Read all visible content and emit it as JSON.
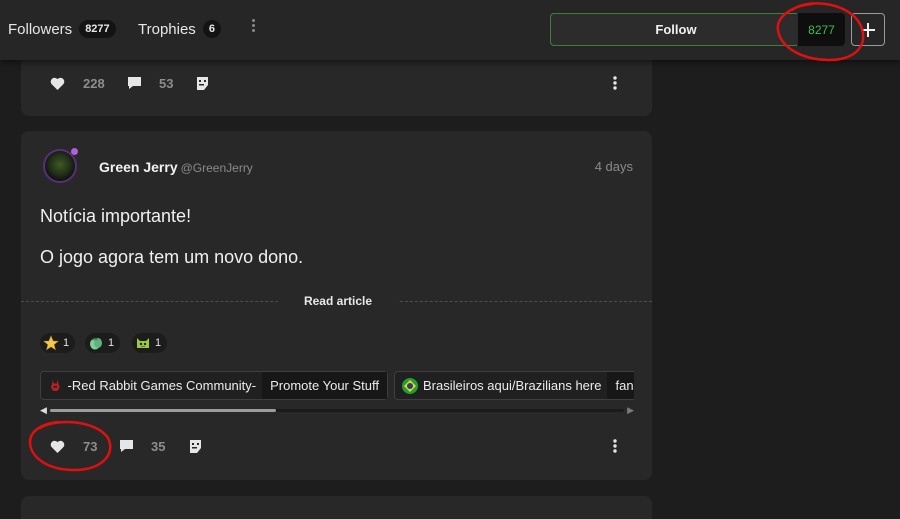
{
  "topbar": {
    "followers_label": "Followers",
    "followers_count": "8277",
    "trophies_label": "Trophies",
    "trophies_count": "6",
    "follow_label": "Follow",
    "follow_count": "8277"
  },
  "previous_post": {
    "likes": "228",
    "comments": "53"
  },
  "post": {
    "author_name": "Green Jerry",
    "author_handle": "@GreenJerry",
    "time": "4 days",
    "lines": [
      "Notícia importante!",
      "O jogo agora tem um novo dono."
    ],
    "read_article_label": "Read article",
    "reactions": [
      {
        "icon": "star-reaction-icon",
        "count": "1"
      },
      {
        "icon": "clapping-hands-reaction-icon",
        "count": "1"
      },
      {
        "icon": "cat-reaction-icon",
        "count": "1"
      }
    ],
    "communities": [
      {
        "name": "-Red Rabbit Games Community-",
        "extra": "Promote Your Stuff"
      },
      {
        "name": "Brasileiros aqui/Brazilians here",
        "extra": "fang"
      }
    ],
    "likes": "73",
    "comments": "35"
  },
  "colors": {
    "accent_green": "#3fbf4a",
    "annotation_red": "#e01010"
  }
}
